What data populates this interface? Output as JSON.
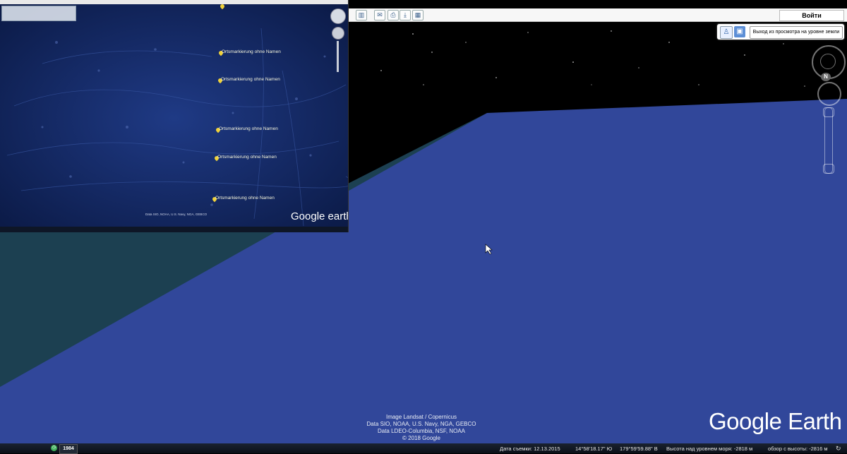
{
  "toolbar": {
    "buttons": [
      "sidebar-toggle",
      "email",
      "print",
      "save-image",
      "view-in-maps"
    ],
    "signin_label": "Войти"
  },
  "ground_view": {
    "exit_label": "Выход из просмотра на уровне земли"
  },
  "compass": {
    "north_label": "N"
  },
  "attribution": {
    "lines": [
      "Image Landsat / Copernicus",
      "Data SIO, NOAA, U.S. Navy, NGA, GEBCO",
      "Data LDEO-Columbia, NSF, NOAA",
      "© 2018 Google"
    ]
  },
  "logo": {
    "text": "Google Earth"
  },
  "status": {
    "year": "1984",
    "imagery_date": "Дата съемки: 12.13.2015",
    "latitude": "14°58'18.17\" Ю",
    "longitude": "179°59'59.88\" В",
    "elevation": "Высота над уровнем моря: -2818 м",
    "eye_alt": "обзор с высоты: -2816 м"
  },
  "inset": {
    "placemark_label": "Ortsmarkierung ohne Namen",
    "attribution": "Data SIO, NOAA, U.S. Navy, NGA, GEBCO",
    "logo_text": "Google earth"
  },
  "colors": {
    "ocean_floor": "#31479a",
    "far_water": "#1c4051",
    "sky": "#000000",
    "placemark": "#f0d23a"
  }
}
